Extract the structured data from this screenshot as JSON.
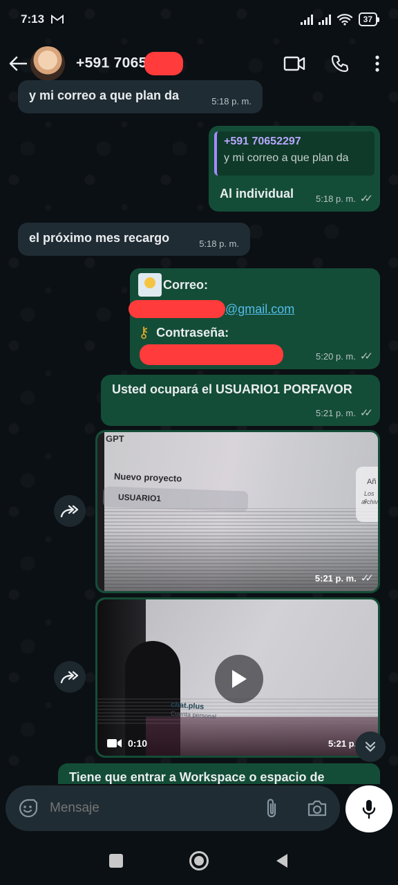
{
  "status": {
    "time": "7:13",
    "battery": "37"
  },
  "header": {
    "contact_name": "+591 7065"
  },
  "messages": {
    "m1": {
      "text": "y mi correo a que plan da",
      "time": "5:18 p. m."
    },
    "m2": {
      "quote_name": "+591 70652297",
      "quote_text": "y mi correo a que plan da",
      "text": "Al individual",
      "time": "5:18 p. m."
    },
    "m3": {
      "text": "el próximo mes recargo",
      "time": "5:18 p. m."
    },
    "m4": {
      "line1": "Correo:",
      "email": "@gmail.com",
      "line2": "Contraseña:",
      "time": "5:20 p. m."
    },
    "m5": {
      "text": "Usted ocupará el USUARIO1 PORFAVOR",
      "time": "5:21 p. m."
    },
    "m6": {
      "time": "5:21 p. m.",
      "screen_top": "GPT",
      "screen_item1": "Nuevo proyecto",
      "screen_item2": "USUARIO1",
      "screen_side1": "Añ",
      "screen_side2": "Los c",
      "screen_side3": "archiv"
    },
    "m7": {
      "time": "5:21 p. m.",
      "duration": "0:10",
      "screen_label1": "chat.plus",
      "screen_label2": "Cuenta personal"
    },
    "m8": {
      "text": "Tiene que entrar a Workspace o espacio de"
    }
  },
  "composer": {
    "placeholder": "Mensaje"
  },
  "colors": {
    "incoming": "#202c33",
    "outgoing": "#144d37",
    "link": "#53bdeb"
  }
}
